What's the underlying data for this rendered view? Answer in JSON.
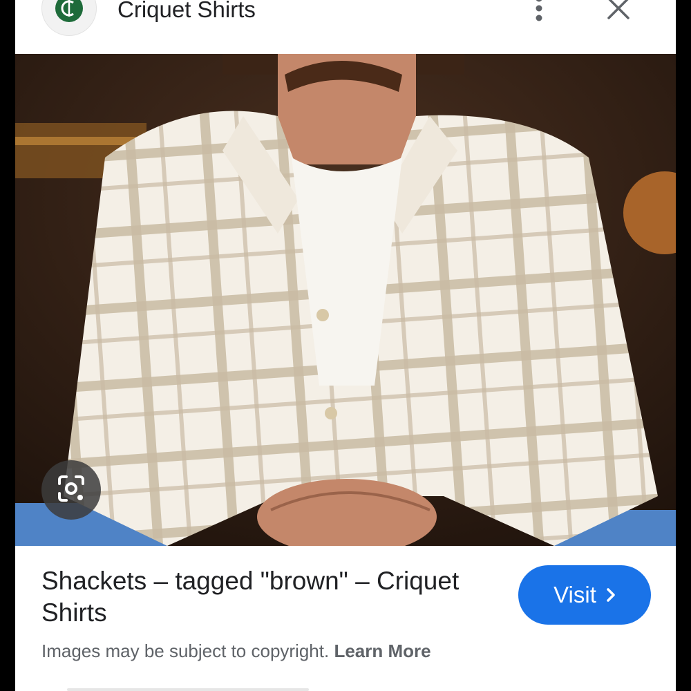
{
  "header": {
    "site_name": "Criquet Shirts",
    "logo_icon": "criquet-logo-icon",
    "more_icon": "more-vert-icon",
    "close_icon": "close-icon"
  },
  "image": {
    "subject": "man-in-sherpa-plaid-shacket",
    "lens_icon": "google-lens-icon"
  },
  "result": {
    "title": "Shackets – tagged \"brown\" – Criquet Shirts",
    "visit_label": "Visit",
    "visit_icon": "chevron-right-icon",
    "copyright_text": "Images may be subject to copyright.",
    "learn_more_label": "Learn More"
  },
  "colors": {
    "accent": "#1a73e8",
    "logo_green": "#1e6b3a"
  }
}
